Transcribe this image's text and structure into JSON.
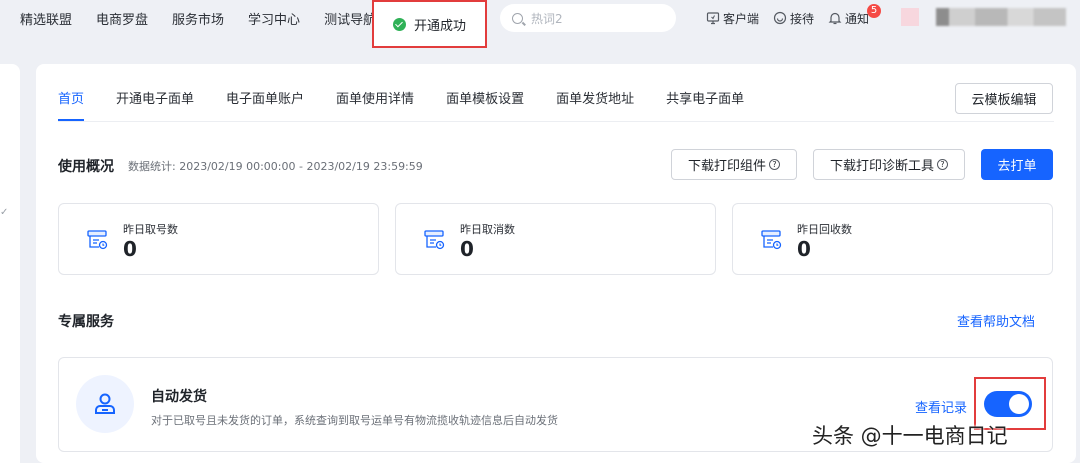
{
  "nav": {
    "items": [
      "精选联盟",
      "电商罗盘",
      "服务市场",
      "学习中心",
      "测试导航"
    ],
    "search_placeholder": "热词2",
    "right": {
      "customer": "客户端",
      "reception": "接待",
      "notice": "通知",
      "notice_count": "5"
    }
  },
  "toast": {
    "text": "开通成功"
  },
  "tabs": [
    "首页",
    "开通电子面单",
    "电子面单账户",
    "面单使用详情",
    "面单模板设置",
    "面单发货地址",
    "共享电子面单"
  ],
  "cloud_button": "云模板编辑",
  "usage": {
    "title": "使用概况",
    "stat_text": "数据统计: 2023/02/19 00:00:00 - 2023/02/19 23:59:59",
    "download_component": "下载打印组件",
    "download_diag": "下载打印诊断工具",
    "go_print": "去打单"
  },
  "stats": [
    {
      "label": "昨日取号数",
      "value": "0"
    },
    {
      "label": "昨日取消数",
      "value": "0"
    },
    {
      "label": "昨日回收数",
      "value": "0"
    }
  ],
  "service": {
    "title": "专属服务",
    "help_link": "查看帮助文档",
    "card": {
      "name": "自动发货",
      "desc": "对于已取号且未发货的订单，系统查询到取号运单号有物流揽收轨迹信息后自动发货",
      "record_link": "查看记录",
      "enabled": true
    }
  },
  "watermark": "头条 @十一电商日记",
  "colors": {
    "accent": "#1664ff",
    "highlight_box": "#e23c3c",
    "success": "#2fb157"
  }
}
